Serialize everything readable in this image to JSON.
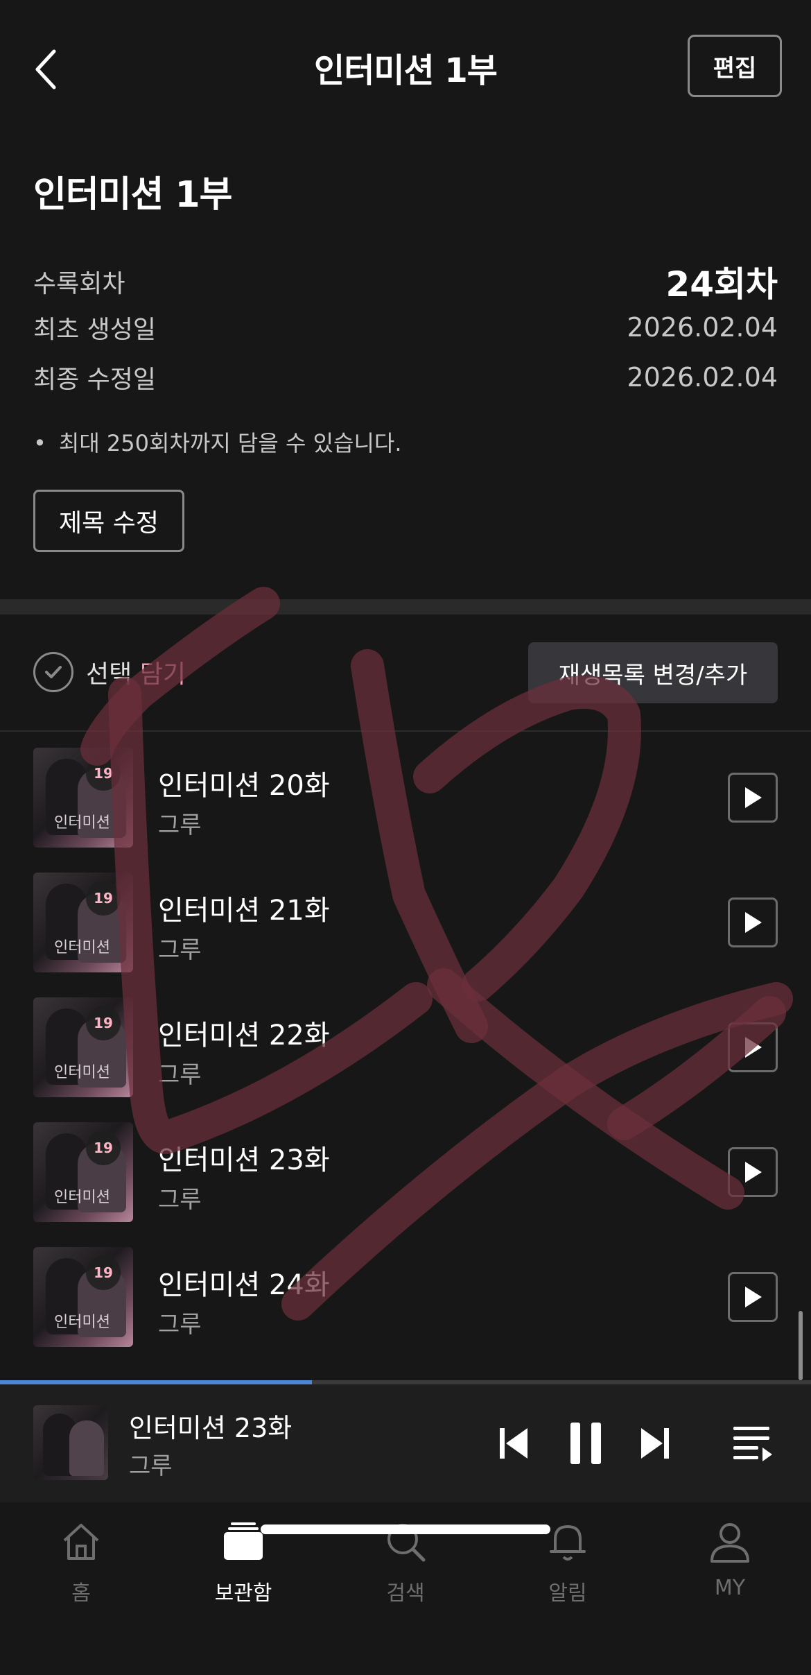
{
  "header": {
    "title": "인터미션 1부",
    "edit_label": "편집"
  },
  "info": {
    "title": "인터미션 1부",
    "rows": [
      {
        "label": "수록회차",
        "value": "24회차"
      },
      {
        "label": "최초 생성일",
        "value": "2026.02.04"
      },
      {
        "label": "최종 수정일",
        "value": "2026.02.04"
      }
    ],
    "note": "최대 250회차까지 담을 수 있습니다.",
    "rename_label": "제목 수정"
  },
  "toolbar": {
    "select_label": "선택",
    "add_label": "담기",
    "change_label": "재생목록 변경/추가"
  },
  "episodes": [
    {
      "title": "인터미션 20화",
      "artist": "그루",
      "age": "19"
    },
    {
      "title": "인터미션 21화",
      "artist": "그루",
      "age": "19"
    },
    {
      "title": "인터미션 22화",
      "artist": "그루",
      "age": "19"
    },
    {
      "title": "인터미션 23화",
      "artist": "그루",
      "age": "19"
    },
    {
      "title": "인터미션 24화",
      "artist": "그루",
      "age": "19"
    }
  ],
  "thumb_logo": "인터미션",
  "player": {
    "title": "인터미션 23화",
    "artist": "그루",
    "progress": 0.385
  },
  "nav": [
    {
      "label": "홈",
      "icon": "home-icon",
      "active": false
    },
    {
      "label": "보관함",
      "icon": "library-icon",
      "active": true
    },
    {
      "label": "검색",
      "icon": "search-icon",
      "active": false
    },
    {
      "label": "알림",
      "icon": "bell-icon",
      "active": false
    },
    {
      "label": "MY",
      "icon": "user-icon",
      "active": false
    }
  ],
  "colors": {
    "background": "#171717",
    "accent_pink": "#f29fb8",
    "progress_blue": "#4b86d7",
    "watermark": "#6b2f3c"
  }
}
